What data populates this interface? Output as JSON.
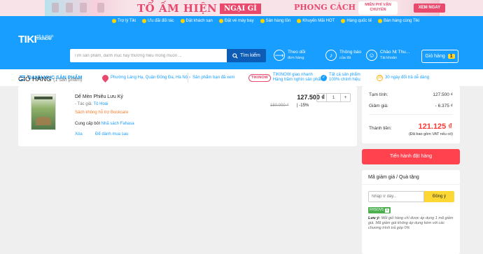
{
  "banner": {
    "title": "TỔ ẤM HIỆN ĐẠI",
    "badge": "NGẠI GÌ",
    "subtitle": "PHONG CÁCH HÀN",
    "free_ship": "MIỄN PHÍ VẬN CHUYỂN",
    "cta": "XEM NGAY"
  },
  "topnav": [
    "Trợ lý Tiki",
    "Ưu đãi đối tác",
    "Đặt khách sạn",
    "Đặt vé máy bay",
    "Sản hàng tồn",
    "Khuyến Mãi HOT",
    "Hàng quốc tế",
    "Bán hàng cùng Tiki"
  ],
  "logo": {
    "name": "TIKI",
    "tagline": "Tốt & nhanh",
    "sub": "TIKINOW"
  },
  "search": {
    "placeholder": "Tìm sản phẩm, danh mục hay thương hiệu mong muốn ...",
    "button": "Tìm kiếm"
  },
  "header": {
    "orders": "Theo dõi",
    "orders_sub": "đơn hàng",
    "notify": "Thông báo",
    "notify_sub": "của tôi",
    "user": "Chào Nt Thu...",
    "user_sub": "Tài khoản",
    "cart": "Giỏ hàng",
    "cart_count": "1"
  },
  "subnav": {
    "menu": "DANH MỤC SẢN PHẨM",
    "location": "Phường Láng Hạ, Quận Đống Đa, Hà Nội",
    "viewed": "Sản phẩm bạn đã xem",
    "tikinow_badge": "TIKINOW",
    "tikinow": "TIKINOW giao nhanh",
    "tikinow_sub": "Hàng trăm nghìn sản phẩm",
    "genuine": "Tất cả sản phẩm",
    "genuine_sub": "100% chính hiệu",
    "returns": "30 ngày đổi trả dễ dàng",
    "returns_icon": "30"
  },
  "cart": {
    "title": "GIỎ HÀNG",
    "count": "(1 sản phẩm)",
    "item": {
      "name": "Dế Mèn Phiêu Lưu Ký",
      "author_label": "- Tác giả:",
      "author": "Tô Hoài",
      "note": "Sách không hỗ trợ Bookcare",
      "provider_label": "Cung cấp bởi",
      "provider": "Nhã sách Fahasa",
      "delete": "Xóa",
      "save_later": "Để dành mua sau",
      "price": "127.500 ₫",
      "old_price": "150.000 ₫",
      "discount": "-15%",
      "quantity": "1",
      "minus": "-",
      "plus": "+"
    }
  },
  "summary": {
    "subtotal_label": "Tạm tính:",
    "subtotal": "127.500 ₫",
    "discount_label": "Giảm giá:",
    "discount": "- 6.375 ₫",
    "total_label": "Thành tiền:",
    "total": "121.125 ₫",
    "vat": "(Đã bao gồm VAT nếu có)",
    "checkout": "Tiến hành đặt hàng"
  },
  "coupon": {
    "title": "Mã giảm giá / Quà tặng",
    "placeholder": "Nhập ở đây..",
    "apply": "Đồng ý",
    "applied_code": "FHSOV5",
    "note_label": "Lưu ý:",
    "note": "Mỗi giỏ hàng chỉ được áp dụng 1 mã giảm giá. Mã giảm giá không áp dụng kèm với các chương trình trả góp 0%"
  },
  "colors": {
    "brand": "#189eff",
    "accent": "#ff424e",
    "price": "#fe3834",
    "coupon": "#fdd835"
  }
}
